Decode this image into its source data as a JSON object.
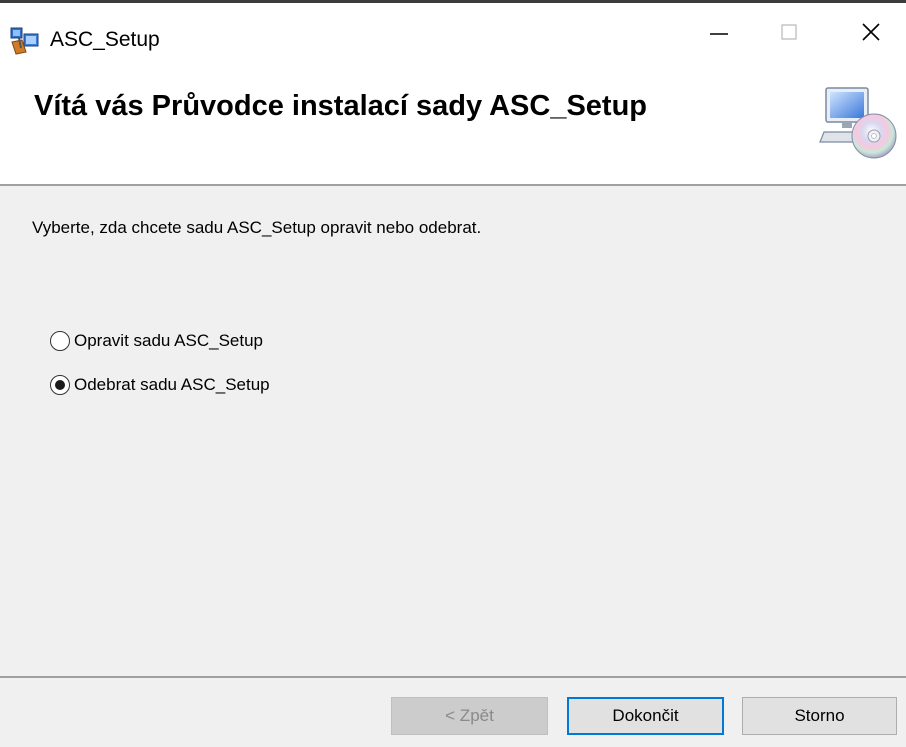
{
  "window": {
    "title": "ASC_Setup",
    "icons": {
      "app": "installer-icon",
      "minimize": "minimize-icon",
      "maximize": "maximize-icon",
      "close": "close-icon"
    }
  },
  "banner": {
    "title": "Vítá vás Průvodce instalací sady ASC_Setup",
    "icon": "computer-cd-icon"
  },
  "body": {
    "instruction": "Vyberte, zda chcete sadu ASC_Setup opravit nebo odebrat.",
    "options": [
      {
        "label": "Opravit sadu ASC_Setup",
        "selected": false
      },
      {
        "label": "Odebrat sadu ASC_Setup",
        "selected": true
      }
    ]
  },
  "footer": {
    "back_label": "< Zpět",
    "back_enabled": false,
    "finish_label": "Dokončit",
    "cancel_label": "Storno"
  },
  "colors": {
    "content_bg": "#f0f0f0",
    "default_button_border": "#0078d7",
    "disabled_text": "#8a8a8a"
  }
}
